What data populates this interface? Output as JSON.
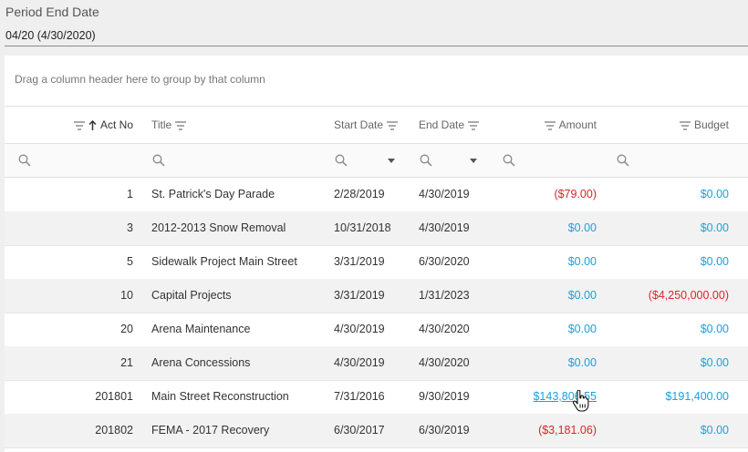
{
  "period": {
    "label": "Period End Date",
    "value": "04/20 (4/30/2020)"
  },
  "grid": {
    "group_panel_text": "Drag a column header here to group by that column",
    "columns": {
      "act_no": "Act No",
      "title": "Title",
      "start_date": "Start Date",
      "end_date": "End Date",
      "amount": "Amount",
      "budget": "Budget"
    },
    "sort": {
      "column": "Act No",
      "direction": "ascending"
    },
    "rows": [
      {
        "act_no": "1",
        "title": "St. Patrick's Day Parade",
        "start_date": "2/28/2019",
        "end_date": "4/30/2019",
        "amount": "($79.00)",
        "budget": "$0.00"
      },
      {
        "act_no": "3",
        "title": "2012-2013 Snow Removal",
        "start_date": "10/31/2018",
        "end_date": "4/30/2019",
        "amount": "$0.00",
        "budget": "$0.00"
      },
      {
        "act_no": "5",
        "title": "Sidewalk Project Main Street",
        "start_date": "3/31/2019",
        "end_date": "6/30/2020",
        "amount": "$0.00",
        "budget": "$0.00"
      },
      {
        "act_no": "10",
        "title": "Capital Projects",
        "start_date": "3/31/2019",
        "end_date": "1/31/2023",
        "amount": "$0.00",
        "budget": "($4,250,000.00)"
      },
      {
        "act_no": "20",
        "title": "Arena Maintenance",
        "start_date": "4/30/2019",
        "end_date": "4/30/2020",
        "amount": "$0.00",
        "budget": "$0.00"
      },
      {
        "act_no": "21",
        "title": "Arena Concessions",
        "start_date": "4/30/2019",
        "end_date": "4/30/2020",
        "amount": "$0.00",
        "budget": "$0.00"
      },
      {
        "act_no": "201801",
        "title": "Main Street Reconstruction",
        "start_date": "7/31/2016",
        "end_date": "9/30/2019",
        "amount": "$143,806.55",
        "budget": "$191,400.00"
      },
      {
        "act_no": "201802",
        "title": "FEMA - 2017 Recovery",
        "start_date": "6/30/2017",
        "end_date": "6/30/2019",
        "amount": "($3,181.06)",
        "budget": "$0.00"
      }
    ]
  },
  "colors": {
    "positive": "#1aa0e0",
    "negative": "#d9262a"
  },
  "icons": [
    "filter-icon",
    "sort-ascending-icon",
    "search-icon",
    "dropdown-caret-icon",
    "hand-pointer-cursor-icon"
  ]
}
